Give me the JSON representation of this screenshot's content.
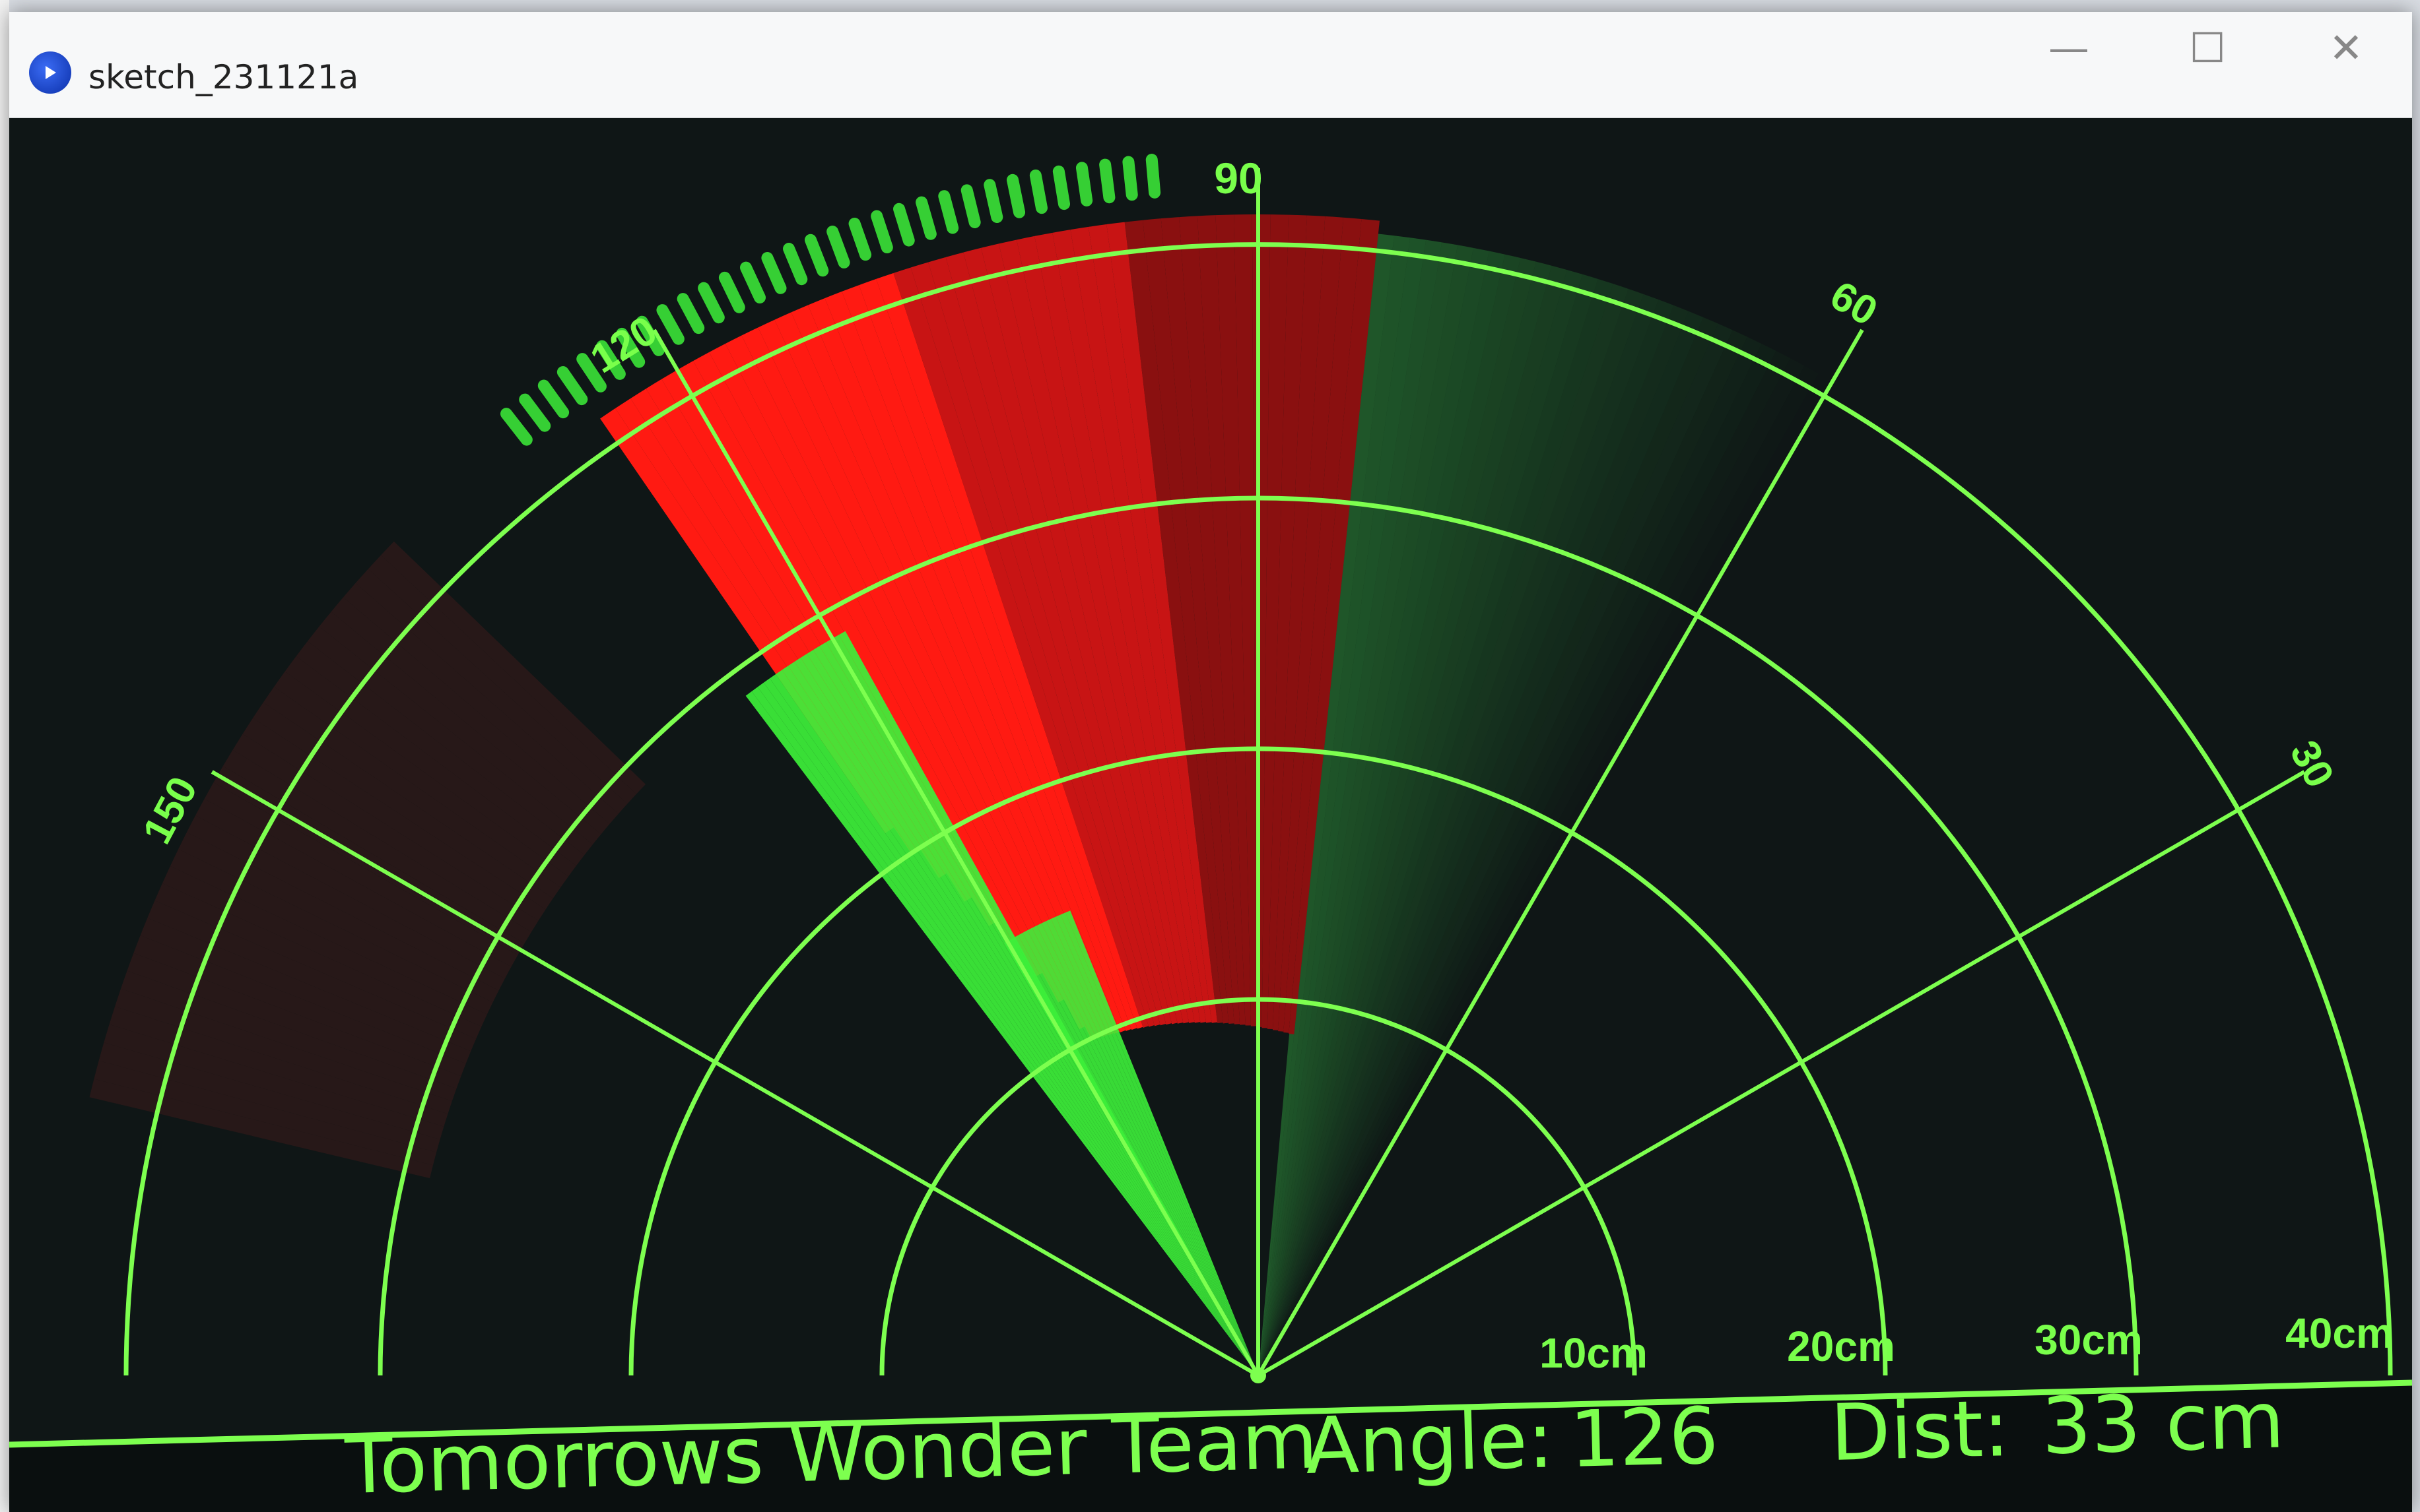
{
  "window": {
    "title": "sketch_231121a",
    "controls": {
      "minimize": "—",
      "maximize": "☐",
      "close": "✕"
    }
  },
  "radar": {
    "angle_labels": [
      "90",
      "60",
      "30",
      "120",
      "150"
    ],
    "distance_labels": [
      "10cm",
      "20cm",
      "30cm",
      "40cm"
    ],
    "team_name": "Tomorrows Wonder Team",
    "angle_label": "Angle:",
    "angle_value": "126",
    "dist_label": "Dist:",
    "dist_value": "33 cm",
    "current_angle_deg": 126,
    "current_distance_cm": 33,
    "colors": {
      "grid": "#7dff4f",
      "sweep": "#3df03a",
      "object": "#ff1a1a",
      "background": "#0f1616"
    }
  }
}
